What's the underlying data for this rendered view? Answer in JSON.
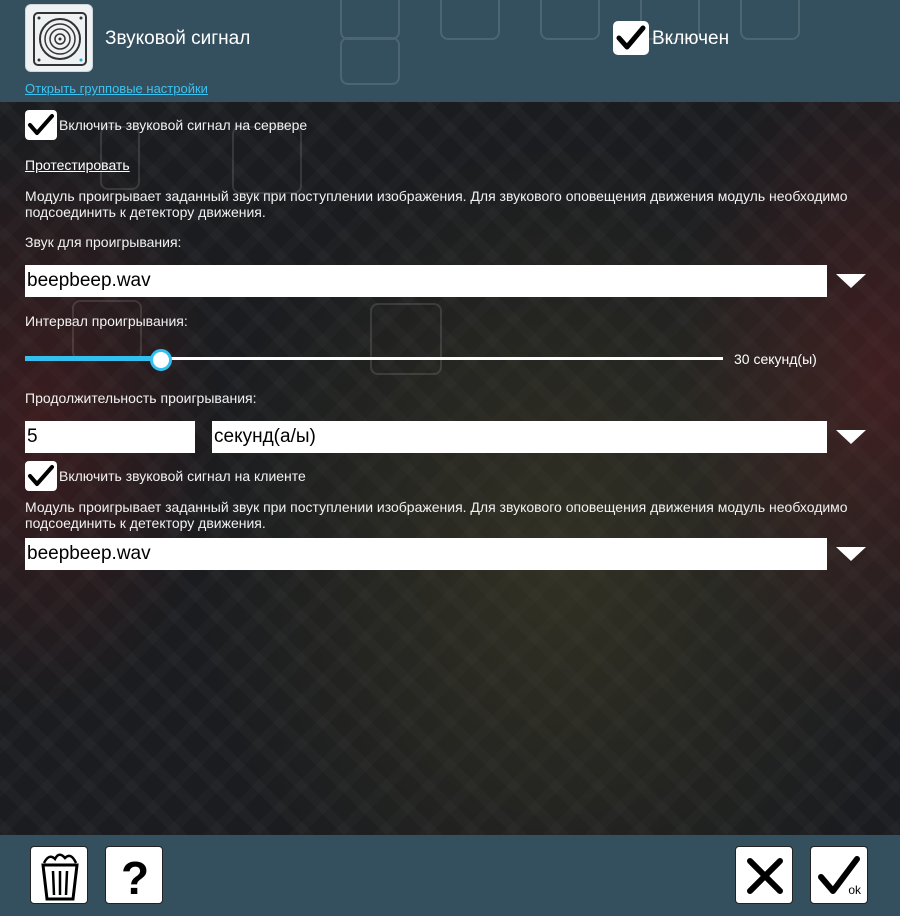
{
  "header": {
    "title": "Звуковой сигнал",
    "enabled_label": "Включен",
    "enabled_checked": true,
    "group_settings_link": "Открыть групповые настройки",
    "icon": "speaker-icon"
  },
  "server": {
    "checkbox_label": "Включить звуковой сигнал на сервере",
    "checked": true,
    "test_link": "Протестировать",
    "description": "Модуль проигрывает заданный звук при поступлении изображения. Для звукового оповещения движения модуль необходимо подсоединить к детектору движения.",
    "sound_label": "Звук для проигрывания:",
    "sound_value": "beepbeep.wav",
    "interval_label": "Интервал проигрывания:",
    "interval_value": "30 секунд(ы)",
    "interval_fraction": 0.195,
    "duration_label": "Продолжительность проигрывания:",
    "duration_value": "5",
    "duration_unit": "секунд(а/ы)"
  },
  "client": {
    "checkbox_label": "Включить звуковой сигнал на клиенте",
    "checked": true,
    "description": "Модуль проигрывает заданный звук при поступлении изображения. Для звукового оповещения движения модуль необходимо подсоединить к детектору движения.",
    "sound_value": "beepbeep.wav"
  },
  "footer": {
    "ok_label": "ok",
    "buttons": [
      "trash-icon",
      "question-icon",
      "close-icon",
      "checkmark-icon"
    ]
  },
  "colors": {
    "accent": "#33c0ee",
    "bar": "#34505e",
    "link": "#3cc2f0"
  }
}
